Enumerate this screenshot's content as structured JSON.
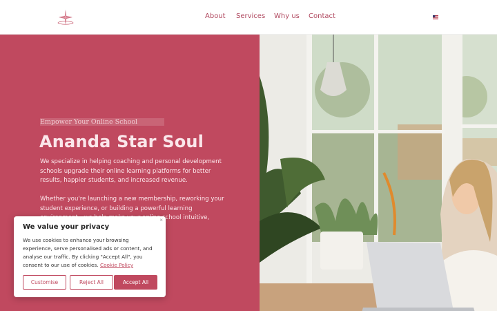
{
  "header": {
    "nav": [
      "About",
      "Services",
      "Why us",
      "Contact"
    ],
    "language_icon": "us-flag-icon",
    "logo_icon": "star-logo-icon"
  },
  "hero": {
    "eyebrow": "Empower Your Online School",
    "title": "Ananda Star Soul",
    "paragraph1": "We specialize in helping coaching and personal development schools upgrade their online learning platforms for better results, happier students, and increased revenue.",
    "paragraph2": "Whether you're launching a new membership, reworking your student experience, or building a powerful learning environment—we help make your online school intuitive, engaging, and",
    "photo": "woman-working-laptop-image"
  },
  "cookie": {
    "title": "We value your privacy",
    "body": "We use cookies to enhance your browsing experience, serve personalised ads or content, and analyse our traffic. By clicking \"Accept All\", you consent to our use of cookies.",
    "policy_link": "Cookie Policy",
    "close": "×",
    "customise": "Customise",
    "reject": "Reject All",
    "accept": "Accept All"
  },
  "colors": {
    "brand": "#c0495f",
    "hero_text": "#fbe7eb"
  }
}
